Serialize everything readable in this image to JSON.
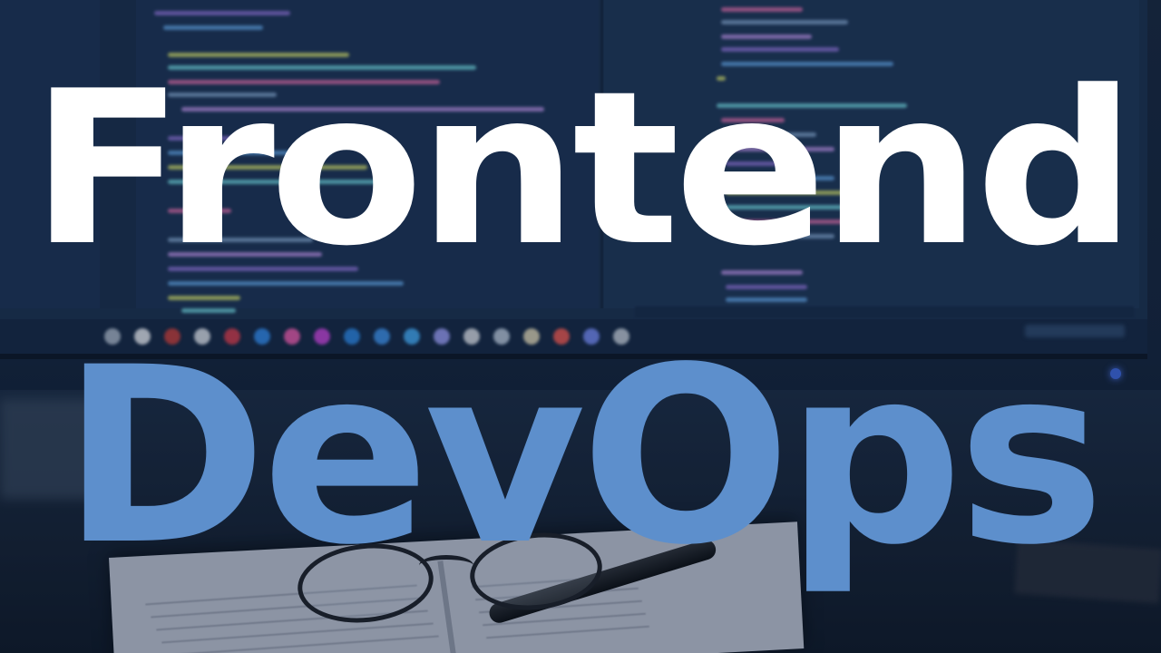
{
  "title_line_1": "Frontend",
  "title_line_2": "DevOps",
  "colors": {
    "title_line_1": "#ffffff",
    "title_line_2": "#5d8fcc",
    "background": "#13223a"
  },
  "icons": {
    "background_scene": "blurred-code-monitor-with-glasses-and-notebook"
  }
}
